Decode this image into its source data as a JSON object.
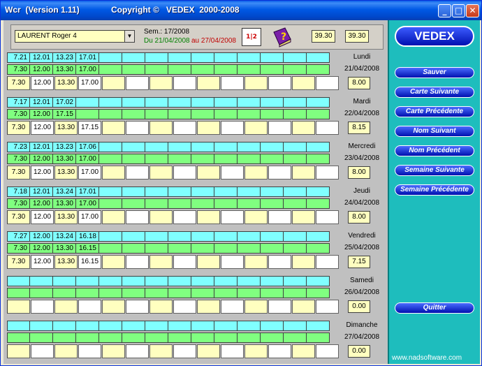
{
  "window": {
    "title": "Wcr  (Version 1.11)",
    "copyright": "Copyright ©   VEDEX  2000-2008"
  },
  "toolbar": {
    "employee": "LAURENT Roger 4",
    "week": "Sem.: 17/2008",
    "range_start": "Du 21/04/2008",
    "range_end": "au 27/04/2008",
    "total1": "39.30",
    "total2": "39.30"
  },
  "days": [
    {
      "name": "Lundi",
      "date": "21/04/2008",
      "total": "8.00",
      "r1": [
        "7.21",
        "12.01",
        "13.23",
        "17.01"
      ],
      "r2": [
        "7.30",
        "12.00",
        "13.30",
        "17.00"
      ],
      "r3": [
        "7.30",
        "12.00",
        "13.30",
        "17.00"
      ]
    },
    {
      "name": "Mardi",
      "date": "22/04/2008",
      "total": "8.15",
      "r1": [
        "7.17",
        "12.01",
        "17.02",
        ""
      ],
      "r2": [
        "7.30",
        "12.00",
        "17.15",
        ""
      ],
      "r3": [
        "7.30",
        "12.00",
        "13.30",
        "17.15"
      ]
    },
    {
      "name": "Mercredi",
      "date": "23/04/2008",
      "total": "8.00",
      "r1": [
        "7.23",
        "12.01",
        "13.23",
        "17.06"
      ],
      "r2": [
        "7.30",
        "12.00",
        "13.30",
        "17.00"
      ],
      "r3": [
        "7.30",
        "12.00",
        "13.30",
        "17.00"
      ]
    },
    {
      "name": "Jeudi",
      "date": "24/04/2008",
      "total": "8.00",
      "r1": [
        "7.18",
        "12.01",
        "13.24",
        "17.01"
      ],
      "r2": [
        "7.30",
        "12.00",
        "13.30",
        "17.00"
      ],
      "r3": [
        "7.30",
        "12.00",
        "13.30",
        "17.00"
      ]
    },
    {
      "name": "Vendredi",
      "date": "25/04/2008",
      "total": "7.15",
      "r1": [
        "7.27",
        "12.00",
        "13.24",
        "16.18"
      ],
      "r2": [
        "7.30",
        "12.00",
        "13.30",
        "16.15"
      ],
      "r3": [
        "7.30",
        "12.00",
        "13.30",
        "16.15"
      ]
    },
    {
      "name": "Samedi",
      "date": "26/04/2008",
      "total": "0.00",
      "r1": [
        "",
        "",
        "",
        ""
      ],
      "r2": [
        "",
        "",
        "",
        ""
      ],
      "r3": [
        "",
        "",
        "",
        ""
      ]
    },
    {
      "name": "Dimanche",
      "date": "27/04/2008",
      "total": "0.00",
      "r1": [
        "",
        "",
        "",
        ""
      ],
      "r2": [
        "",
        "",
        "",
        ""
      ],
      "r3": [
        "",
        "",
        "",
        ""
      ]
    }
  ],
  "sidebar": {
    "brand": "VEDEX",
    "buttons": [
      "Sauver",
      "Carte Suivante",
      "Carte Précédente",
      "Nom Suivant",
      "Nom Précédent",
      "Semaine Suivante",
      "Semaine Précédente"
    ],
    "quit": "Quitter",
    "footer": "www.nadsoftware.com"
  },
  "colors": {
    "accent": "#0010b0",
    "panel": "#1ebdbd",
    "row_cyan": "#80ffff",
    "row_green": "#80ff80",
    "input_yellow": "#ffffc0"
  }
}
